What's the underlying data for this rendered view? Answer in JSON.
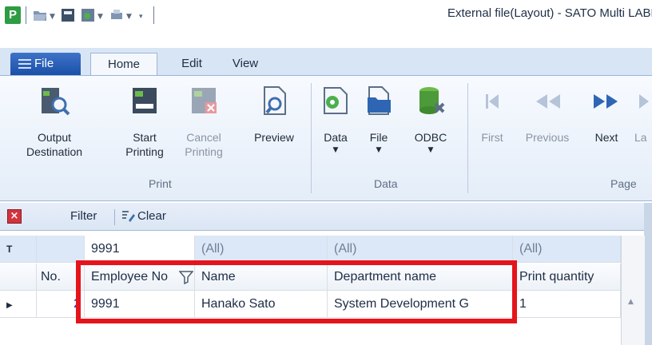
{
  "window": {
    "title": "External file(Layout) - SATO Multi LABEL"
  },
  "quick_access": {
    "app_letter": "P"
  },
  "tabs": {
    "file": "File",
    "home": "Home",
    "edit": "Edit",
    "view": "View"
  },
  "ribbon": {
    "print": {
      "label": "Print",
      "output_line1": "Output",
      "output_line2": "Destination",
      "start_line1": "Start",
      "start_line2": "Printing",
      "cancel_line1": "Cancel",
      "cancel_line2": "Printing",
      "preview": "Preview"
    },
    "data": {
      "label": "Data",
      "data": "Data",
      "file": "File",
      "odbc": "ODBC"
    },
    "page": {
      "label": "Page",
      "first": "First",
      "previous": "Previous",
      "next": "Next",
      "last": "La"
    }
  },
  "filterbar": {
    "filter": "Filter",
    "clear": "Clear"
  },
  "grid": {
    "filter_marker": "T",
    "filter_row": {
      "employee_no": "9991",
      "name": "(All)",
      "department": "(All)",
      "print_quantity": "(All)"
    },
    "headers": {
      "no": "No.",
      "employee_no": "Employee No",
      "name": "Name",
      "department": "Department name",
      "print_quantity": "Print quantity"
    },
    "rows": [
      {
        "no": "2",
        "employee_no": "9991",
        "name": "Hanako Sato",
        "department": "System Development G",
        "print_quantity": "1"
      }
    ]
  },
  "colors": {
    "highlight": "#e5141c",
    "file_tab": "#1a50a8",
    "accent": "#2e9c42"
  }
}
